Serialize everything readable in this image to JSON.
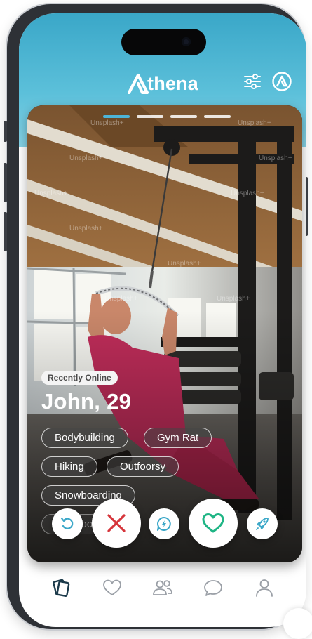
{
  "app": {
    "name": "Athena",
    "logo_letter": "A",
    "logo_rest": "thena",
    "brand_color": "#3aa7c8",
    "header_icons": [
      "filter-sliders-icon",
      "athena-badge-icon"
    ]
  },
  "card": {
    "photo_progress": {
      "total": 4,
      "active_index": 0
    },
    "watermark": "Unsplash+",
    "status_badge": "Recently Online",
    "name_age": "John, 29",
    "tags": [
      "Bodybuilding",
      "Gym Rat",
      "Hiking",
      "Outfoorsy",
      "Snowboarding"
    ],
    "partially_hidden_tag": "Snowboarding"
  },
  "actions": [
    {
      "name": "rewind",
      "icon": "rewind-icon",
      "color": "#3aa7c8"
    },
    {
      "name": "pass",
      "icon": "close-x-icon",
      "color": "#d6353b"
    },
    {
      "name": "message",
      "icon": "lightning-chat-icon",
      "color": "#3aa7c8"
    },
    {
      "name": "like",
      "icon": "heart-icon",
      "color": "#1fb585"
    },
    {
      "name": "boost",
      "icon": "rocket-icon",
      "color": "#3aa7c8"
    }
  ],
  "tabbar": {
    "items": [
      {
        "name": "discover",
        "icon": "cards-icon",
        "active": true
      },
      {
        "name": "likes",
        "icon": "heart-outline-icon",
        "active": false
      },
      {
        "name": "matches",
        "icon": "people-icon",
        "active": false
      },
      {
        "name": "chats",
        "icon": "chat-bubble-icon",
        "active": false
      },
      {
        "name": "profile",
        "icon": "person-icon",
        "active": false
      }
    ],
    "active_color": "#1b3a4a",
    "inactive_color": "#9a9fa6"
  }
}
